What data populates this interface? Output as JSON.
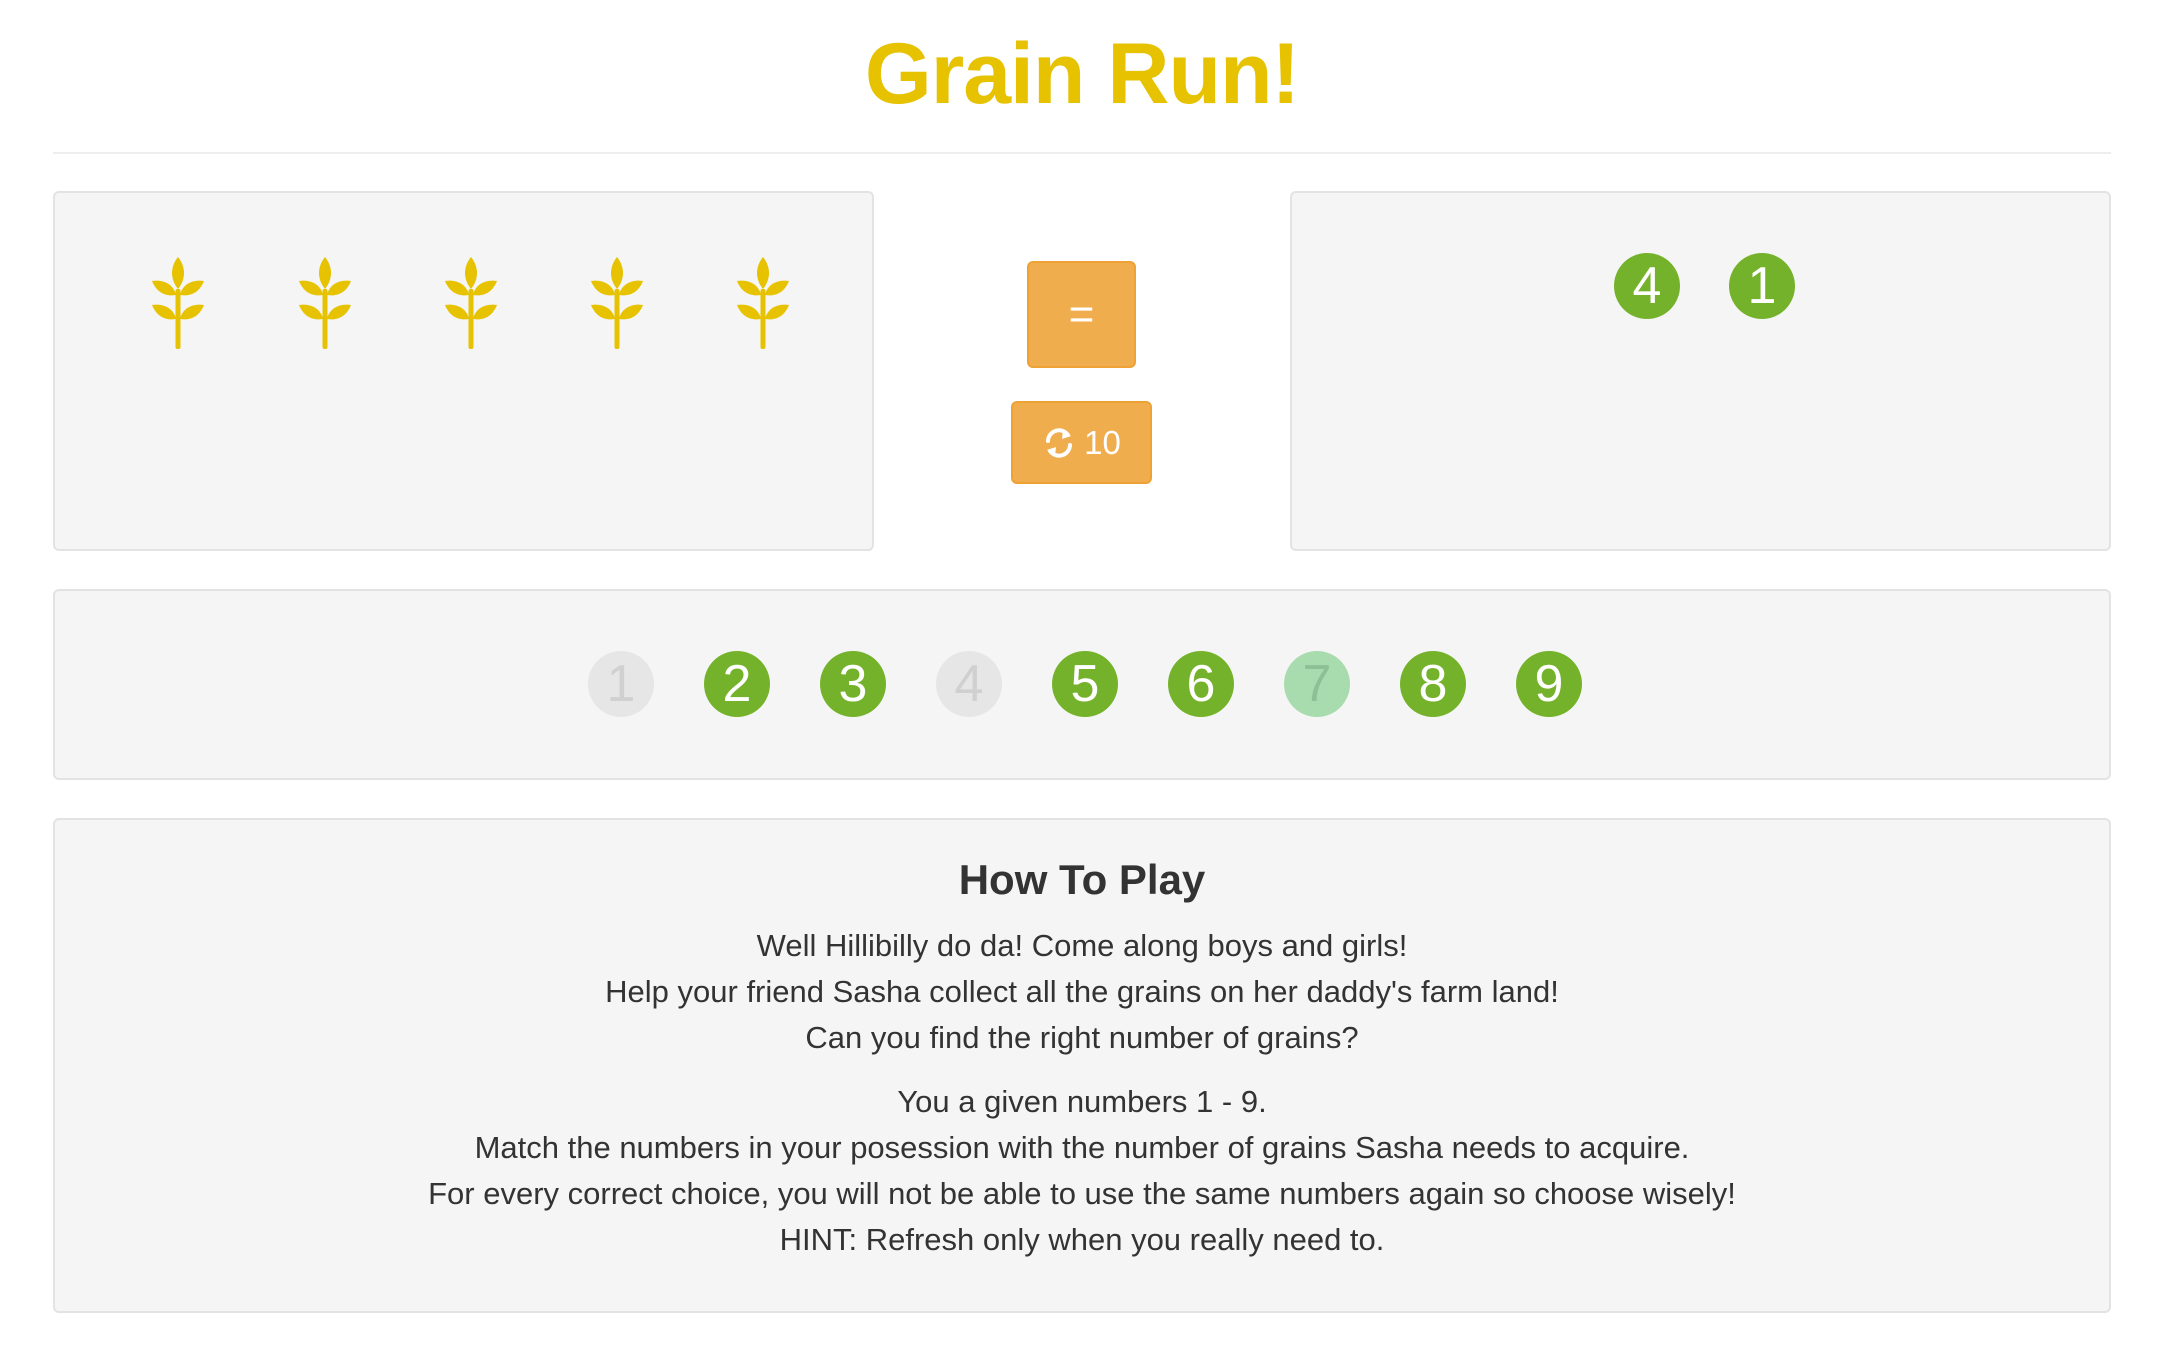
{
  "title": "Grain Run!",
  "grains": {
    "count": 5,
    "icon": "wheat-icon",
    "color": "#e6c200"
  },
  "controls": {
    "equals_label": "=",
    "refresh_icon": "refresh-icon",
    "refresh_count": "10"
  },
  "selected_numbers": [
    "4",
    "1"
  ],
  "numbers": [
    {
      "label": "1",
      "state": "used"
    },
    {
      "label": "2",
      "state": "available"
    },
    {
      "label": "3",
      "state": "available"
    },
    {
      "label": "4",
      "state": "used"
    },
    {
      "label": "5",
      "state": "available"
    },
    {
      "label": "6",
      "state": "available"
    },
    {
      "label": "7",
      "state": "wrong"
    },
    {
      "label": "8",
      "state": "available"
    },
    {
      "label": "9",
      "state": "available"
    }
  ],
  "how_to_play": {
    "heading": "How To Play",
    "lines": [
      "Well Hillibilly do da! Come along boys and girls!",
      "Help your friend Sasha collect all the grains on her daddy's farm land!",
      "Can you find the right number of grains?",
      "You a given numbers 1 - 9.",
      "Match the numbers in your posession with the number of grains Sasha needs to acquire.",
      "For every correct choice, you will not be able to use the same numbers again so choose wisely!",
      "HINT: Refresh only when you really need to."
    ]
  },
  "colors": {
    "title": "#e6c200",
    "button": "#f0ad4e",
    "number_available": "#75b22b",
    "number_used": "#e6e6e6",
    "number_wrong": "#a8dcae"
  }
}
